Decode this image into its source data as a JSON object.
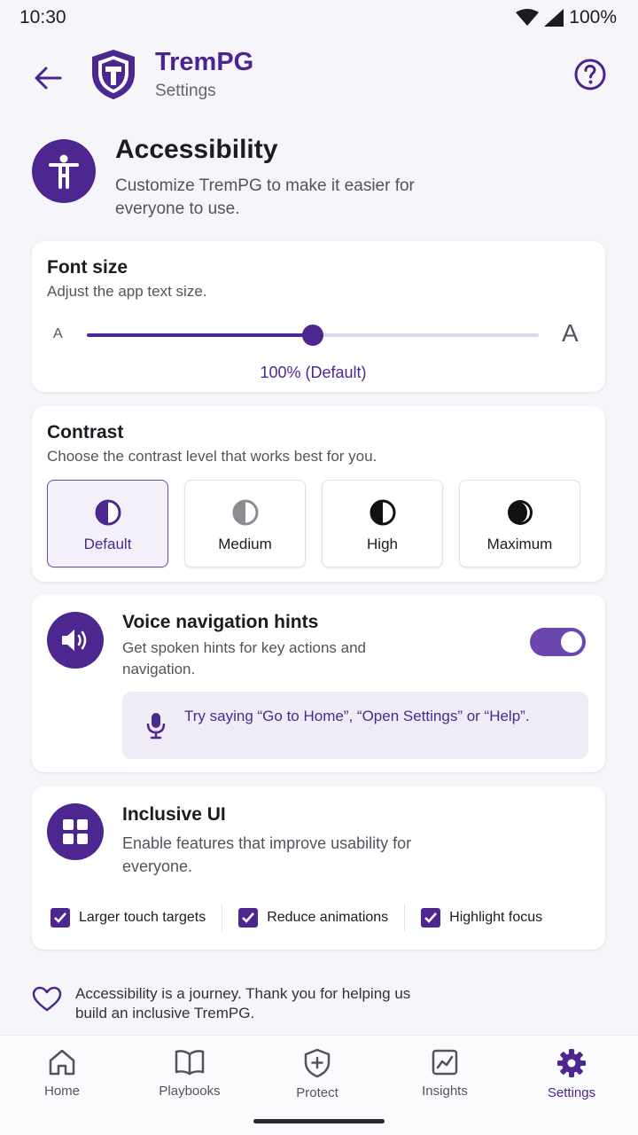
{
  "status": {
    "time": "10:30",
    "battery": "100%"
  },
  "appbar": {
    "title": "TremPG",
    "subtitle": "Settings",
    "logo_letter": "T"
  },
  "hero": {
    "title": "Accessibility",
    "description": "Customize TremPG to make it easier for everyone to use."
  },
  "font_size": {
    "title": "Font size",
    "description": "Adjust the app text size.",
    "small_label": "A",
    "large_label": "A",
    "slider_fraction": 0.5,
    "value_label": "100% (Default)"
  },
  "contrast": {
    "title": "Contrast",
    "description": "Choose the contrast level that works best for you.",
    "options": [
      {
        "label": "Default",
        "selected": true
      },
      {
        "label": "Medium",
        "selected": false
      },
      {
        "label": "High",
        "selected": false
      },
      {
        "label": "Maximum",
        "selected": false
      }
    ]
  },
  "voice": {
    "title": "Voice navigation hints",
    "description": "Get spoken hints for key actions and navigation.",
    "enabled": true,
    "hint": "Try saying “Go to Home”, “Open Settings” or “Help”."
  },
  "inclusive": {
    "title": "Inclusive UI",
    "description": "Enable features that improve usability for everyone.",
    "checks": [
      {
        "label": "Larger touch targets",
        "checked": true
      },
      {
        "label": "Reduce animations",
        "checked": true
      },
      {
        "label": "Highlight focus",
        "checked": true
      }
    ]
  },
  "footer": {
    "text": "Accessibility is a journey. Thank you for helping us build an inclusive TremPG."
  },
  "nav": {
    "items": [
      {
        "label": "Home",
        "icon": "home-icon"
      },
      {
        "label": "Playbooks",
        "icon": "book-icon"
      },
      {
        "label": "Protect",
        "icon": "shield-plus-icon"
      },
      {
        "label": "Insights",
        "icon": "chart-icon"
      },
      {
        "label": "Settings",
        "icon": "gear-icon",
        "active": true
      }
    ]
  },
  "colors": {
    "accent": "#4d2790",
    "background": "#f6f5f9",
    "card": "#ffffff"
  }
}
